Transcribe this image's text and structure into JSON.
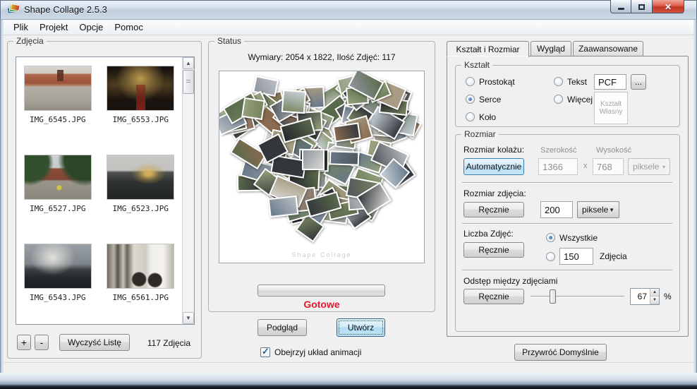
{
  "window": {
    "title": "Shape Collage 2.5.3"
  },
  "menu": {
    "items": [
      "Plik",
      "Projekt",
      "Opcje",
      "Pomoc"
    ]
  },
  "photos_panel": {
    "title": "Zdjęcia",
    "items": [
      {
        "filename": "IMG_6545.JPG"
      },
      {
        "filename": "IMG_6553.JPG"
      },
      {
        "filename": "IMG_6527.JPG"
      },
      {
        "filename": "IMG_6523.JPG"
      },
      {
        "filename": "IMG_6543.JPG"
      },
      {
        "filename": "IMG_6561.JPG"
      }
    ],
    "add_button": "+",
    "remove_button": "-",
    "clear_button": "Wyczyść Listę",
    "count_label": "117 Zdjęcia"
  },
  "status_panel": {
    "title": "Status",
    "dimensions_text": "Wymiary: 2054 x 1822, Ilość Zdjęć: 117",
    "status_text": "Gotowe",
    "status_color": "#e8192c",
    "preview_button": "Podgląd",
    "create_button": "Utwórz",
    "animation_label": "Obejrzyj układ animacji",
    "animation_checked": true,
    "watermark": "Shape Collage",
    "preview": {
      "shape": "heart",
      "tile_count": 117,
      "palette": [
        "#77855f",
        "#93a07b",
        "#5a6a4c",
        "#8f969c",
        "#b9bec3",
        "#50555a",
        "#33373b",
        "#a99c84",
        "#c6d0d8",
        "#66788a",
        "#8a6a50",
        "#23262a",
        "#d9d9d4",
        "#6b7d5a"
      ]
    }
  },
  "settings_panel": {
    "tabs": [
      {
        "label": "Kształt i Rozmiar",
        "active": true
      },
      {
        "label": "Wygląd",
        "active": false
      },
      {
        "label": "Zaawansowane",
        "active": false
      }
    ],
    "shape_group": {
      "title": "Kształt",
      "options": [
        {
          "label": "Prostokąt",
          "selected": false
        },
        {
          "label": "Serce",
          "selected": true
        },
        {
          "label": "Koło",
          "selected": false
        },
        {
          "label": "Tekst",
          "selected": false
        },
        {
          "label": "Więcej",
          "selected": false
        }
      ],
      "text_value": "PCF",
      "browse_button": "...",
      "custom_shape_button": "Kształt Własny"
    },
    "size_group": {
      "title": "Rozmiar",
      "collage_size": {
        "label": "Rozmiar kolażu:",
        "auto_button": "Automatycznie",
        "width_label": "Szerokość",
        "width_value": "1366",
        "x_separator": "x",
        "height_label": "Wysokość",
        "height_value": "768",
        "unit": "piksele"
      },
      "photo_size": {
        "label": "Rozmiar zdjęcia:",
        "manual_button": "Ręcznie",
        "value": "200",
        "unit": "piksele"
      },
      "photo_count": {
        "label": "Liczba Zdjęć:",
        "manual_button": "Ręcznie",
        "all_label": "Wszystkie",
        "all_selected": true,
        "custom_value": "150",
        "custom_suffix": "Zdjęcia"
      },
      "spacing": {
        "label": "Odstęp między zdjęciami",
        "manual_button": "Ręcznie",
        "value": "67",
        "unit": "%",
        "slider_percent": 23
      }
    },
    "restore_button": "Przywróć Domyślnie"
  }
}
